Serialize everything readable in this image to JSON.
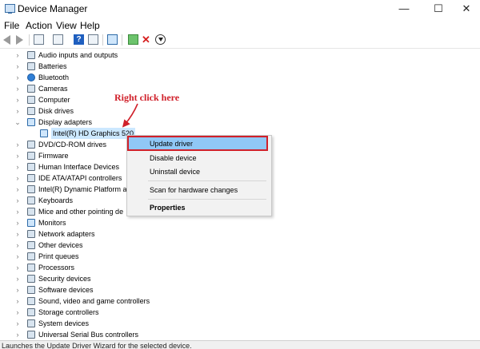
{
  "window": {
    "title": "Device Manager",
    "controls": {
      "minimize": "—",
      "maximize": "☐",
      "close": "✕"
    }
  },
  "menu": [
    "File",
    "Action",
    "View",
    "Help"
  ],
  "toolbar": {
    "icons": [
      "back-icon",
      "forward-icon",
      "properties-icon",
      "list-icon",
      "help-icon",
      "view-icon",
      "monitor-icon",
      "enable-device-icon",
      "uninstall-icon",
      "update-icon"
    ]
  },
  "tree": {
    "items": [
      {
        "label": "Audio inputs and outputs",
        "icon": "speaker-icon"
      },
      {
        "label": "Batteries",
        "icon": "battery-icon"
      },
      {
        "label": "Bluetooth",
        "icon": "bluetooth-icon"
      },
      {
        "label": "Cameras",
        "icon": "camera-icon"
      },
      {
        "label": "Computer",
        "icon": "computer-icon"
      },
      {
        "label": "Disk drives",
        "icon": "disk-icon"
      },
      {
        "label": "Display adapters",
        "icon": "display-adapter-icon",
        "expanded": true
      },
      {
        "label": "Intel(R) HD Graphics 520",
        "icon": "monitor-icon",
        "child": true,
        "selected": true
      },
      {
        "label": "DVD/CD-ROM drives",
        "icon": "dvd-icon"
      },
      {
        "label": "Firmware",
        "icon": "firmware-icon"
      },
      {
        "label": "Human Interface Devices",
        "icon": "hid-icon"
      },
      {
        "label": "IDE ATA/ATAPI controllers",
        "icon": "ide-icon"
      },
      {
        "label": "Intel(R) Dynamic Platform ar",
        "icon": "chip-icon"
      },
      {
        "label": "Keyboards",
        "icon": "keyboard-icon"
      },
      {
        "label": "Mice and other pointing de",
        "icon": "mouse-icon"
      },
      {
        "label": "Monitors",
        "icon": "monitor-icon"
      },
      {
        "label": "Network adapters",
        "icon": "network-icon"
      },
      {
        "label": "Other devices",
        "icon": "other-device-icon"
      },
      {
        "label": "Print queues",
        "icon": "printer-icon"
      },
      {
        "label": "Processors",
        "icon": "processor-icon"
      },
      {
        "label": "Security devices",
        "icon": "security-icon"
      },
      {
        "label": "Software devices",
        "icon": "software-icon"
      },
      {
        "label": "Sound, video and game controllers",
        "icon": "sound-icon"
      },
      {
        "label": "Storage controllers",
        "icon": "storage-icon"
      },
      {
        "label": "System devices",
        "icon": "system-icon"
      },
      {
        "label": "Universal Serial Bus controllers",
        "icon": "usb-icon"
      }
    ]
  },
  "annotation": {
    "text": "Right click here",
    "color": "#d0202a"
  },
  "context_menu": {
    "items": [
      "Update driver",
      "Disable device",
      "Uninstall device",
      "Scan for hardware changes",
      "Properties"
    ],
    "highlighted": "Update driver",
    "highlight_color": "#90c8f6"
  },
  "status": {
    "text": "Launches the Update Driver Wizard for the selected device."
  }
}
